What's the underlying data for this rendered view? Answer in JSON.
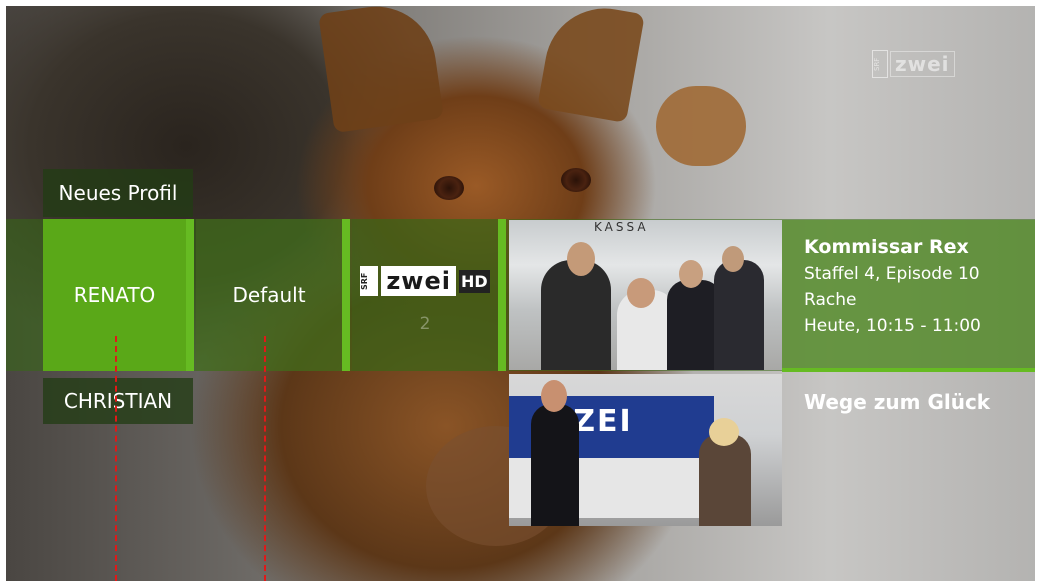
{
  "channel_watermark": {
    "srf": "SRF",
    "name": "zwei"
  },
  "profiles": {
    "new_profile_label": "Neues Profil",
    "selected": "RENATO",
    "items": [
      "RENATO",
      "Default"
    ],
    "below": "CHRISTIAN"
  },
  "channel_tile": {
    "srf": "SRF",
    "name": "zwei",
    "hd": "HD",
    "number": "2"
  },
  "now_playing": {
    "title": "Kommissar Rex",
    "episode": "Staffel 4, Episode 10",
    "subtitle": "Rache",
    "time": "Heute, 10:15 - 11:00",
    "thumb_sign": "KASSA"
  },
  "next_program": {
    "title": "Wege zum Glück",
    "thumb_sign": "LIZEI"
  },
  "colors": {
    "accent": "#66bb22",
    "selected_tile": "#5aa818",
    "band": "#376914",
    "highlight": "#e01818"
  }
}
